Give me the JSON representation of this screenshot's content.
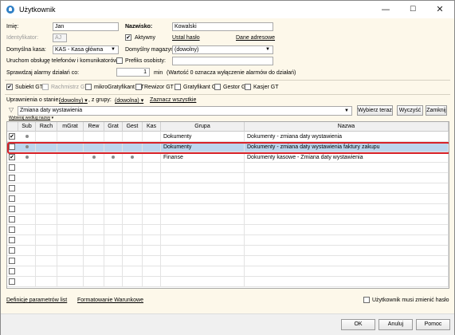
{
  "window": {
    "title": "Użytkownik"
  },
  "form": {
    "imie_label": "Imię:",
    "imie_value": "Jan",
    "nazwisko_label": "Nazwisko:",
    "nazwisko_value": "Kowalski",
    "identyfikator_label": "Identyfikator:",
    "identyfikator_value": "AJ",
    "aktywny_label": "Aktywny",
    "aktywny_checked": true,
    "ustal_haslo": "Ustal hasło",
    "dane_adresowe": "Dane adresowe",
    "kasa_label": "Domyślna kasa:",
    "kasa_value": "KAS - Kasa główna",
    "magazyn_label": "Domyślny magazyn:",
    "magazyn_value": "(dowolny)",
    "uruchom_label": "Uruchom obsługę telefonów i komunikatorów",
    "prefiks_label": "Prefiks osobisty:",
    "prefiks_value": "",
    "alarmy_label": "Sprawdzaj alarmy działań co:",
    "alarmy_value": "1",
    "alarmy_unit": "min",
    "alarmy_note": "(Wartość 0 oznacza wyłączenie alarmów do działań)"
  },
  "roles": [
    {
      "label": "Subiekt GT",
      "checked": true,
      "disabled": false
    },
    {
      "label": "Rachmistrz GT",
      "checked": false,
      "disabled": true
    },
    {
      "label": "mikroGratyfikant GT",
      "checked": false,
      "disabled": false
    },
    {
      "label": "Rewizor GT",
      "checked": false,
      "disabled": false
    },
    {
      "label": "Gratyfikant GT",
      "checked": false,
      "disabled": false
    },
    {
      "label": "Gestor GT",
      "checked": false,
      "disabled": false
    },
    {
      "label": "Kasjer GT",
      "checked": false,
      "disabled": false
    }
  ],
  "filter": {
    "uprawnienia_label": "Uprawnienia o stanie:",
    "stan_value": "(dowolny)",
    "z_grupy_label": ", z grupy:",
    "grupa_value": "(dowolna)",
    "zaznacz_wszystkie": "Zaznacz wszystkie",
    "search_value": "Zmiana daty wystawienia",
    "wybierz_teraz": "Wybierz teraz",
    "wyczysc": "Wyczyść",
    "zamknij": "Zamknij",
    "wybieraj_wedlug": "Wybieraj według nazwy"
  },
  "grid": {
    "columns": [
      "Sub",
      "Rach",
      "mGrat",
      "Rew",
      "Grat",
      "Gest",
      "Kas",
      "Grupa",
      "Nazwa"
    ],
    "rows": [
      {
        "checked": true,
        "marks": [
          true,
          false,
          false,
          false,
          false,
          false,
          false
        ],
        "grupa": "Dokumenty",
        "nazwa": "Dokumenty - zmiana daty wystawienia",
        "selected": false
      },
      {
        "checked": false,
        "marks": [
          true,
          false,
          false,
          false,
          false,
          false,
          false
        ],
        "grupa": "Dokumenty",
        "nazwa": "Dokumenty - zmiana daty wystawienia faktury zakupu",
        "selected": true
      },
      {
        "checked": true,
        "marks": [
          true,
          false,
          false,
          true,
          true,
          true,
          false
        ],
        "grupa": "Finanse",
        "nazwa": "Dokumenty kasowe - Zmiana daty wystawienia",
        "selected": false
      }
    ]
  },
  "bottom": {
    "definicje": "Definicje parametrów list",
    "formatowanie": "Formatowanie Warunkowe",
    "musi_zmienic": "Użytkownik musi zmienić hasło"
  },
  "buttons": {
    "ok": "OK",
    "anuluj": "Anuluj",
    "pomoc": "Pomoc"
  }
}
